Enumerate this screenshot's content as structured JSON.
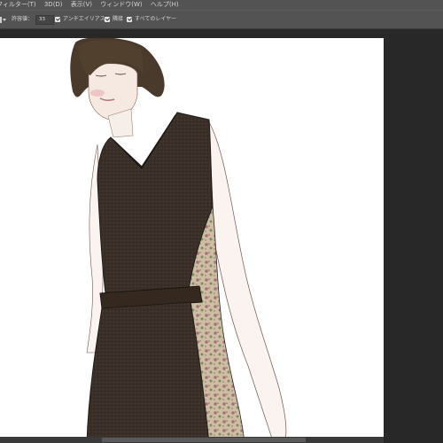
{
  "menubar": {
    "items": [
      "フィルター(T)",
      "3D(D)",
      "表示(V)",
      "ウィンドウ(W)",
      "ヘルプ(H)"
    ]
  },
  "options": {
    "tolerance_label": "許容値：",
    "tolerance_value": "33",
    "antialias_label": "アンチエイリアス",
    "contiguous_label": "隣接",
    "all_layers_label": "すべてのレイヤー"
  },
  "icons": [
    "magic-wand-tool-icon",
    "dropdown-arrow-icon",
    "checkbox-checked-icon"
  ],
  "colors": {
    "ui_panel": "#535353",
    "workspace": "#282828",
    "canvas": "#ffffff",
    "dress": "#3b3029",
    "floral_panel": "#c9b79c",
    "hair": "#4a3a2c"
  }
}
